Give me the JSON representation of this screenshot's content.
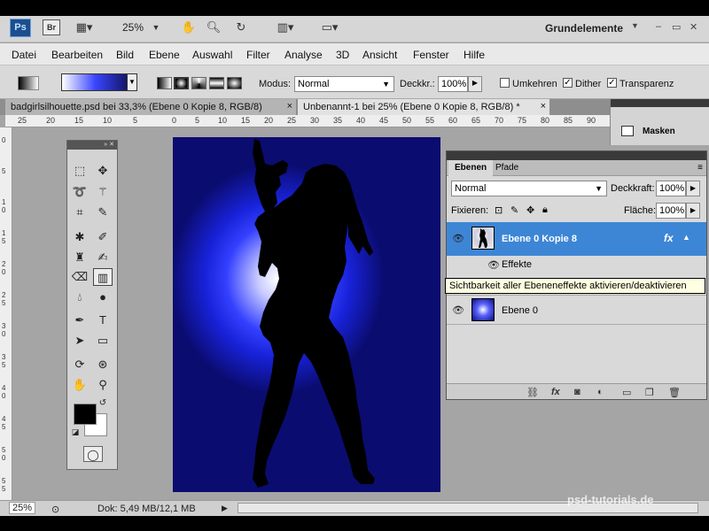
{
  "appbar": {
    "ps_logo": "Ps",
    "br_logo": "Br",
    "zoom": "25%",
    "workspace": "Grundelemente",
    "icons": [
      "hand-icon",
      "zoom-icon",
      "rotate-view-icon",
      "arrange-documents-icon",
      "screen-mode-icon"
    ]
  },
  "menu": [
    "Datei",
    "Bearbeiten",
    "Bild",
    "Ebene",
    "Auswahl",
    "Filter",
    "Analyse",
    "3D",
    "Ansicht",
    "Fenster",
    "Hilfe"
  ],
  "options": {
    "modus_label": "Modus:",
    "modus_value": "Normal",
    "deckkr_label": "Deckkr.:",
    "deckkr_value": "100%",
    "umkehren": "Umkehren",
    "dither": "Dither",
    "transparenz": "Transparenz"
  },
  "tabs": [
    {
      "label": "badgirlsilhouette.psd bei 33,3% (Ebene 0 Kopie 8, RGB/8)",
      "active": false
    },
    {
      "label": "Unbenannt-1 bei 25% (Ebene 0 Kopie 8, RGB/8) *",
      "active": true
    }
  ],
  "ruler_h": [
    "25",
    "20",
    "15",
    "10",
    "5",
    "0",
    "5",
    "10",
    "15",
    "20",
    "25",
    "30",
    "35",
    "40",
    "45",
    "50",
    "55",
    "60",
    "65",
    "70",
    "75",
    "80",
    "85",
    "90"
  ],
  "ruler_v": [
    "0",
    "5",
    "1 0",
    "1 5",
    "2 0",
    "2 5",
    "3 0",
    "3 5",
    "4 0",
    "4 5",
    "5 0",
    "5 5"
  ],
  "masken_panel": {
    "label": "Masken"
  },
  "layers_panel": {
    "tabs": [
      "Ebenen",
      "Pfade"
    ],
    "blend_mode": "Normal",
    "opacity_label": "Deckkraft:",
    "opacity": "100%",
    "lock_label": "Fixieren:",
    "fill_label": "Fläche:",
    "fill": "100%",
    "layers": [
      {
        "name": "Ebene 0 Kopie 8",
        "selected": true,
        "fx": "fx"
      },
      {
        "name": "Effekte",
        "sub": true
      },
      {
        "name": "Ebene 0",
        "selected": false
      }
    ]
  },
  "tooltip": "Sichtbarkeit aller Ebeneneffekte aktivieren/deaktivieren",
  "status": {
    "zoom": "25%",
    "doc": "Dok: 5,49 MB/12,1 MB"
  },
  "watermark": "psd-tutorials.de"
}
